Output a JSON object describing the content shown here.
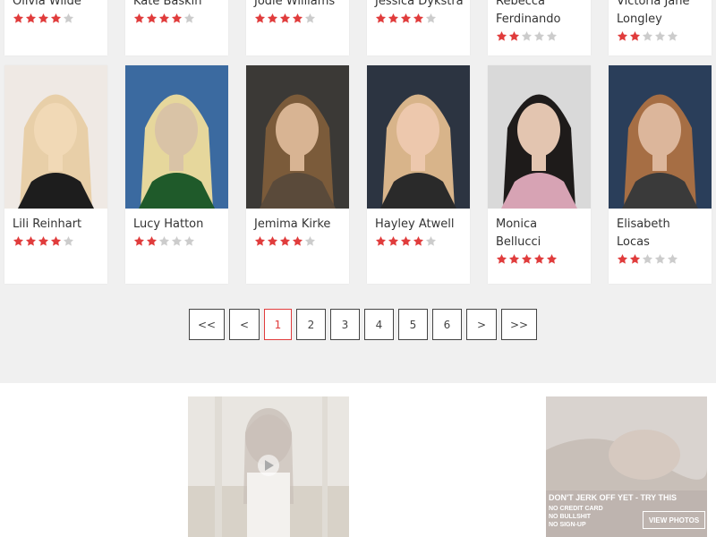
{
  "colors": {
    "star_on": "#e03c3c",
    "star_off": "#cccccc",
    "accent": "#e03c3c"
  },
  "top_row": [
    {
      "name": "Olivia Wilde",
      "rating": 4
    },
    {
      "name": "Kate Baskin",
      "rating": 4
    },
    {
      "name": "Jodie Williams",
      "rating": 4
    },
    {
      "name": "Jessica Dykstra",
      "rating": 4
    },
    {
      "name": "Rebecca Ferdinando",
      "rating": 2
    },
    {
      "name": "Victoria Jane Longley",
      "rating": 2
    }
  ],
  "cards": [
    {
      "name": "Lili Reinhart",
      "rating": 4
    },
    {
      "name": "Lucy Hatton",
      "rating": 2
    },
    {
      "name": "Jemima Kirke",
      "rating": 4
    },
    {
      "name": "Hayley Atwell",
      "rating": 4
    },
    {
      "name": "Monica Bellucci",
      "rating": 5
    },
    {
      "name": "Elisabeth Locas",
      "rating": 2
    }
  ],
  "pagination": {
    "first": "<<",
    "prev": "<",
    "pages": [
      "1",
      "2",
      "3",
      "4",
      "5",
      "6"
    ],
    "current": "1",
    "next": ">",
    "last": ">>"
  },
  "ads": {
    "right_banner_lines": [
      "DON'T JERK OFF YET - TRY THIS",
      "NO CREDIT CARD",
      "NO BULLSHIT",
      "NO SIGN-UP"
    ],
    "right_banner_button": "VIEW PHOTOS"
  }
}
